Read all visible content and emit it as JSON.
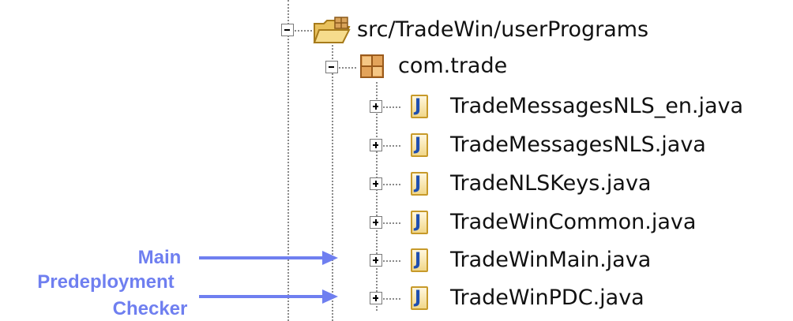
{
  "tree": {
    "source_folder": {
      "label": "src/TradeWin/userPrograms",
      "icon": "package-folder-icon",
      "expanded": true
    },
    "package": {
      "label": "com.trade",
      "icon": "package-icon",
      "expanded": true
    },
    "files": [
      {
        "label": "TradeMessagesNLS_en.java",
        "icon": "java-file-icon",
        "expanded": false
      },
      {
        "label": "TradeMessagesNLS.java",
        "icon": "java-file-icon",
        "expanded": false
      },
      {
        "label": "TradeNLSKeys.java",
        "icon": "java-file-icon",
        "expanded": false
      },
      {
        "label": "TradeWinCommon.java",
        "icon": "java-file-icon",
        "expanded": false
      },
      {
        "label": "TradeWinMain.java",
        "icon": "java-file-icon",
        "expanded": false
      },
      {
        "label": "TradeWinPDC.java",
        "icon": "java-file-icon",
        "expanded": false
      }
    ]
  },
  "callouts": {
    "main": "Main",
    "pdc_line1": "Predeployment",
    "pdc_line2": "Checker"
  },
  "colors": {
    "callout": "#6f7ff0",
    "java_icon_letter": "#1f4fb0",
    "tree_lines": "#8a8a8a"
  }
}
